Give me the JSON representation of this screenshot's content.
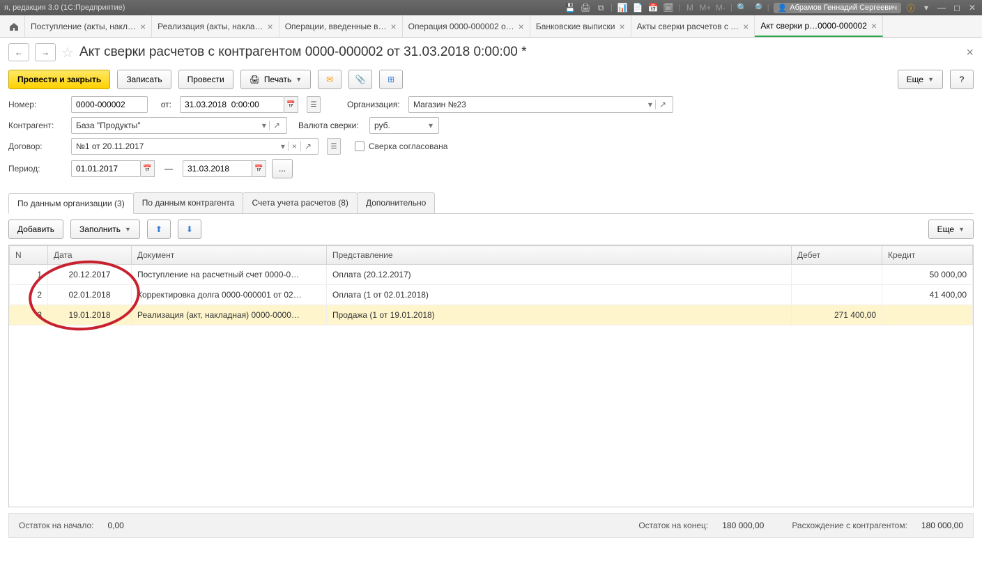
{
  "titlebar": {
    "app_title": "я, редакция 3.0  (1С:Предприятие)",
    "user": "Абрамов Геннадий Сергеевич",
    "m_labels": [
      "M",
      "M+",
      "M-"
    ]
  },
  "tabs": [
    {
      "label": "Поступление (акты, накл…"
    },
    {
      "label": "Реализация (акты, накла…"
    },
    {
      "label": "Операции, введенные в…"
    },
    {
      "label": "Операция 0000-000002 о…"
    },
    {
      "label": "Банковские выписки"
    },
    {
      "label": "Акты сверки расчетов с …"
    },
    {
      "label": "Акт сверки р…0000-000002",
      "active": true
    }
  ],
  "page": {
    "title": "Акт сверки расчетов с контрагентом 0000-000002 от 31.03.2018 0:00:00 *"
  },
  "toolbar": {
    "post_close": "Провести и закрыть",
    "write": "Записать",
    "post": "Провести",
    "print": "Печать",
    "more": "Еще",
    "help": "?"
  },
  "form": {
    "number_label": "Номер:",
    "number": "0000-000002",
    "from_label": "от:",
    "date": "31.03.2018  0:00:00",
    "org_label": "Организация:",
    "org": "Магазин №23",
    "partner_label": "Контрагент:",
    "partner": "База \"Продукты\"",
    "currency_label": "Валюта сверки:",
    "currency": "руб.",
    "contract_label": "Договор:",
    "contract": "№1 от 20.11.2017",
    "agreed_label": "Сверка согласована",
    "period_label": "Период:",
    "period_from": "01.01.2017",
    "period_dash": "—",
    "period_to": "31.03.2018",
    "period_more": "..."
  },
  "inner_tabs": [
    {
      "label": "По данным организации (3)",
      "active": true
    },
    {
      "label": "По данным контрагента"
    },
    {
      "label": "Счета учета расчетов (8)"
    },
    {
      "label": "Дополнительно"
    }
  ],
  "table_toolbar": {
    "add": "Добавить",
    "fill": "Заполнить",
    "more": "Еще"
  },
  "table": {
    "headers": {
      "n": "N",
      "date": "Дата",
      "doc": "Документ",
      "rep": "Представление",
      "deb": "Дебет",
      "cred": "Кредит"
    },
    "rows": [
      {
        "n": "1",
        "date": "20.12.2017",
        "doc": "Поступление на расчетный счет 0000-0…",
        "rep": "Оплата (20.12.2017)",
        "deb": "",
        "cred": "50 000,00"
      },
      {
        "n": "2",
        "date": "02.01.2018",
        "doc": "Корректировка долга 0000-000001 от 02…",
        "rep": "Оплата (1 от 02.01.2018)",
        "deb": "",
        "cred": "41 400,00"
      },
      {
        "n": "3",
        "date": "19.01.2018",
        "doc": "Реализация (акт, накладная) 0000-0000…",
        "rep": "Продажа (1 от 19.01.2018)",
        "deb": "271 400,00",
        "cred": "",
        "selected": true
      }
    ]
  },
  "footer": {
    "start_label": "Остаток на начало:",
    "start_val": "0,00",
    "end_label": "Остаток на конец:",
    "end_val": "180 000,00",
    "diff_label": "Расхождение с контрагентом:",
    "diff_val": "180 000,00"
  }
}
